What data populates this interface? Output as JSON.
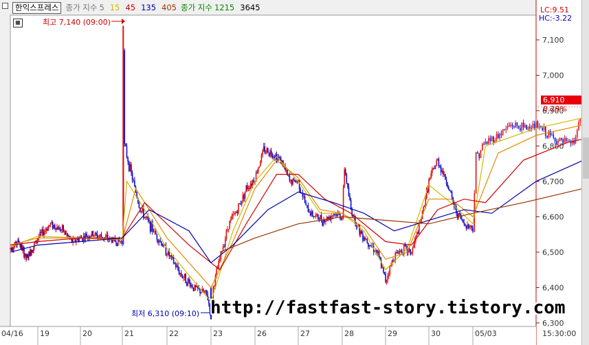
{
  "header": {
    "instrument": "한익스프레스",
    "ma_label": "종가 지수",
    "ma_periods": [
      "5",
      "15",
      "45",
      "135",
      "405"
    ],
    "ma_label2": "종가 지수",
    "ma_periods2": [
      "1215",
      "3645"
    ]
  },
  "right_panel": {
    "lc": "LC:9.51",
    "hc": "HC:-3.22",
    "price_tag": "6,910",
    "change_pct": "0.29%"
  },
  "annotations": {
    "high": "최고 7,140 (09:00)",
    "low": "최저 6,310 (09:10)"
  },
  "watermark": "http://fastfast-story.tistory.com",
  "colors": {
    "ma5": "#d4b800",
    "ma15": "#e08a00",
    "ma45": "#cc0000",
    "ma135": "#0000aa",
    "ma405": "#993300",
    "ma1215": "#008800",
    "price_tag_bg": "#e8000b",
    "up": "#e01010",
    "down": "#1010cc"
  },
  "chart_data": {
    "type": "line",
    "title": "한익스프레스",
    "y_axis_ticks": [
      "7,100",
      "7,000",
      "6,900",
      "6,800",
      "6,700",
      "6,600",
      "6,500",
      "6,400",
      "6,300"
    ],
    "ylim": [
      6290,
      7170
    ],
    "x_axis_labels": [
      "04/16",
      "19",
      "20",
      "21",
      "22",
      "23",
      "26",
      "27",
      "28",
      "29",
      "30",
      "05/03",
      "15:30:00"
    ],
    "high": {
      "value": 7140,
      "time": "09:00"
    },
    "low": {
      "value": 6310,
      "time": "09:10"
    },
    "last": 6910,
    "price_series": [
      [
        0,
        6510
      ],
      [
        0.3,
        6530
      ],
      [
        0.6,
        6480
      ],
      [
        0.8,
        6510
      ],
      [
        1,
        6540
      ],
      [
        1.3,
        6580
      ],
      [
        1.6,
        6560
      ],
      [
        1.8,
        6530
      ],
      [
        2,
        6540
      ],
      [
        2.3,
        6550
      ],
      [
        2.6,
        6540
      ],
      [
        2.9,
        6530
      ],
      [
        3,
        6530
      ],
      [
        3.02,
        7140
      ],
      [
        3.05,
        6800
      ],
      [
        3.2,
        6720
      ],
      [
        3.4,
        6620
      ],
      [
        3.7,
        6560
      ],
      [
        4,
        6500
      ],
      [
        4.3,
        6440
      ],
      [
        4.6,
        6400
      ],
      [
        4.9,
        6380
      ],
      [
        5,
        6330
      ],
      [
        5.05,
        6400
      ],
      [
        5.2,
        6480
      ],
      [
        5.4,
        6580
      ],
      [
        5.6,
        6620
      ],
      [
        5.8,
        6680
      ],
      [
        6,
        6710
      ],
      [
        6.2,
        6790
      ],
      [
        6.4,
        6780
      ],
      [
        6.6,
        6760
      ],
      [
        6.8,
        6700
      ],
      [
        7,
        6700
      ],
      [
        7.2,
        6620
      ],
      [
        7.4,
        6600
      ],
      [
        7.6,
        6590
      ],
      [
        7.8,
        6610
      ],
      [
        8,
        6600
      ],
      [
        8.05,
        6740
      ],
      [
        8.2,
        6620
      ],
      [
        8.4,
        6560
      ],
      [
        8.6,
        6530
      ],
      [
        8.8,
        6500
      ],
      [
        9,
        6420
      ],
      [
        9.2,
        6490
      ],
      [
        9.4,
        6510
      ],
      [
        9.6,
        6500
      ],
      [
        9.8,
        6580
      ],
      [
        10,
        6700
      ],
      [
        10.2,
        6760
      ],
      [
        10.4,
        6700
      ],
      [
        10.6,
        6620
      ],
      [
        10.8,
        6580
      ],
      [
        11,
        6570
      ],
      [
        11.05,
        6770
      ],
      [
        11.2,
        6810
      ],
      [
        11.4,
        6830
      ],
      [
        11.6,
        6860
      ],
      [
        11.8,
        6850
      ],
      [
        12,
        6860
      ],
      [
        12.2,
        6830
      ],
      [
        12.4,
        6810
      ],
      [
        12.6,
        6810
      ],
      [
        12.75,
        6910
      ]
    ],
    "series": [
      {
        "name": "5",
        "values": [
          [
            0,
            6515
          ],
          [
            1,
            6545
          ],
          [
            2,
            6540
          ],
          [
            3,
            6535
          ],
          [
            3.1,
            6700
          ],
          [
            3.5,
            6620
          ],
          [
            4,
            6510
          ],
          [
            5,
            6360
          ],
          [
            5.5,
            6560
          ],
          [
            6,
            6700
          ],
          [
            6.5,
            6770
          ],
          [
            7,
            6700
          ],
          [
            7.5,
            6610
          ],
          [
            8,
            6610
          ],
          [
            8.5,
            6560
          ],
          [
            9,
            6450
          ],
          [
            9.5,
            6510
          ],
          [
            10,
            6690
          ],
          [
            10.5,
            6640
          ],
          [
            11,
            6580
          ],
          [
            11.2,
            6800
          ],
          [
            12,
            6850
          ],
          [
            12.75,
            6880
          ]
        ]
      },
      {
        "name": "15",
        "values": [
          [
            0,
            6520
          ],
          [
            1,
            6540
          ],
          [
            2,
            6540
          ],
          [
            3,
            6535
          ],
          [
            3.3,
            6680
          ],
          [
            4,
            6540
          ],
          [
            5,
            6400
          ],
          [
            5.5,
            6530
          ],
          [
            6,
            6680
          ],
          [
            6.5,
            6760
          ],
          [
            7,
            6710
          ],
          [
            7.5,
            6620
          ],
          [
            8,
            6610
          ],
          [
            8.5,
            6570
          ],
          [
            9,
            6480
          ],
          [
            9.5,
            6500
          ],
          [
            10,
            6650
          ],
          [
            10.5,
            6650
          ],
          [
            11,
            6600
          ],
          [
            11.4,
            6780
          ],
          [
            12,
            6830
          ],
          [
            12.75,
            6860
          ]
        ]
      },
      {
        "name": "45",
        "values": [
          [
            0,
            6520
          ],
          [
            1,
            6530
          ],
          [
            2,
            6540
          ],
          [
            3,
            6540
          ],
          [
            3.5,
            6640
          ],
          [
            4.5,
            6520
          ],
          [
            5.2,
            6450
          ],
          [
            5.8,
            6580
          ],
          [
            6.5,
            6720
          ],
          [
            7,
            6720
          ],
          [
            7.6,
            6650
          ],
          [
            8.2,
            6610
          ],
          [
            9,
            6530
          ],
          [
            9.6,
            6520
          ],
          [
            10.2,
            6620
          ],
          [
            10.8,
            6650
          ],
          [
            11.2,
            6640
          ],
          [
            11.8,
            6760
          ],
          [
            12.5,
            6810
          ],
          [
            12.75,
            6820
          ]
        ]
      },
      {
        "name": "135",
        "values": [
          [
            0,
            6500
          ],
          [
            1,
            6520
          ],
          [
            2,
            6530
          ],
          [
            3,
            6540
          ],
          [
            3.6,
            6620
          ],
          [
            4.5,
            6560
          ],
          [
            5,
            6470
          ],
          [
            5.5,
            6520
          ],
          [
            6.3,
            6620
          ],
          [
            7,
            6670
          ],
          [
            7.8,
            6640
          ],
          [
            8.5,
            6610
          ],
          [
            9.2,
            6560
          ],
          [
            10,
            6590
          ],
          [
            10.8,
            6620
          ],
          [
            11.3,
            6610
          ],
          [
            12,
            6700
          ],
          [
            12.75,
            6760
          ]
        ]
      },
      {
        "name": "405",
        "values": [
          [
            5.2,
            6500
          ],
          [
            6,
            6540
          ],
          [
            7,
            6580
          ],
          [
            8,
            6600
          ],
          [
            9,
            6590
          ],
          [
            10,
            6580
          ],
          [
            11,
            6610
          ],
          [
            11.8,
            6640
          ],
          [
            12.75,
            6680
          ]
        ]
      }
    ]
  }
}
